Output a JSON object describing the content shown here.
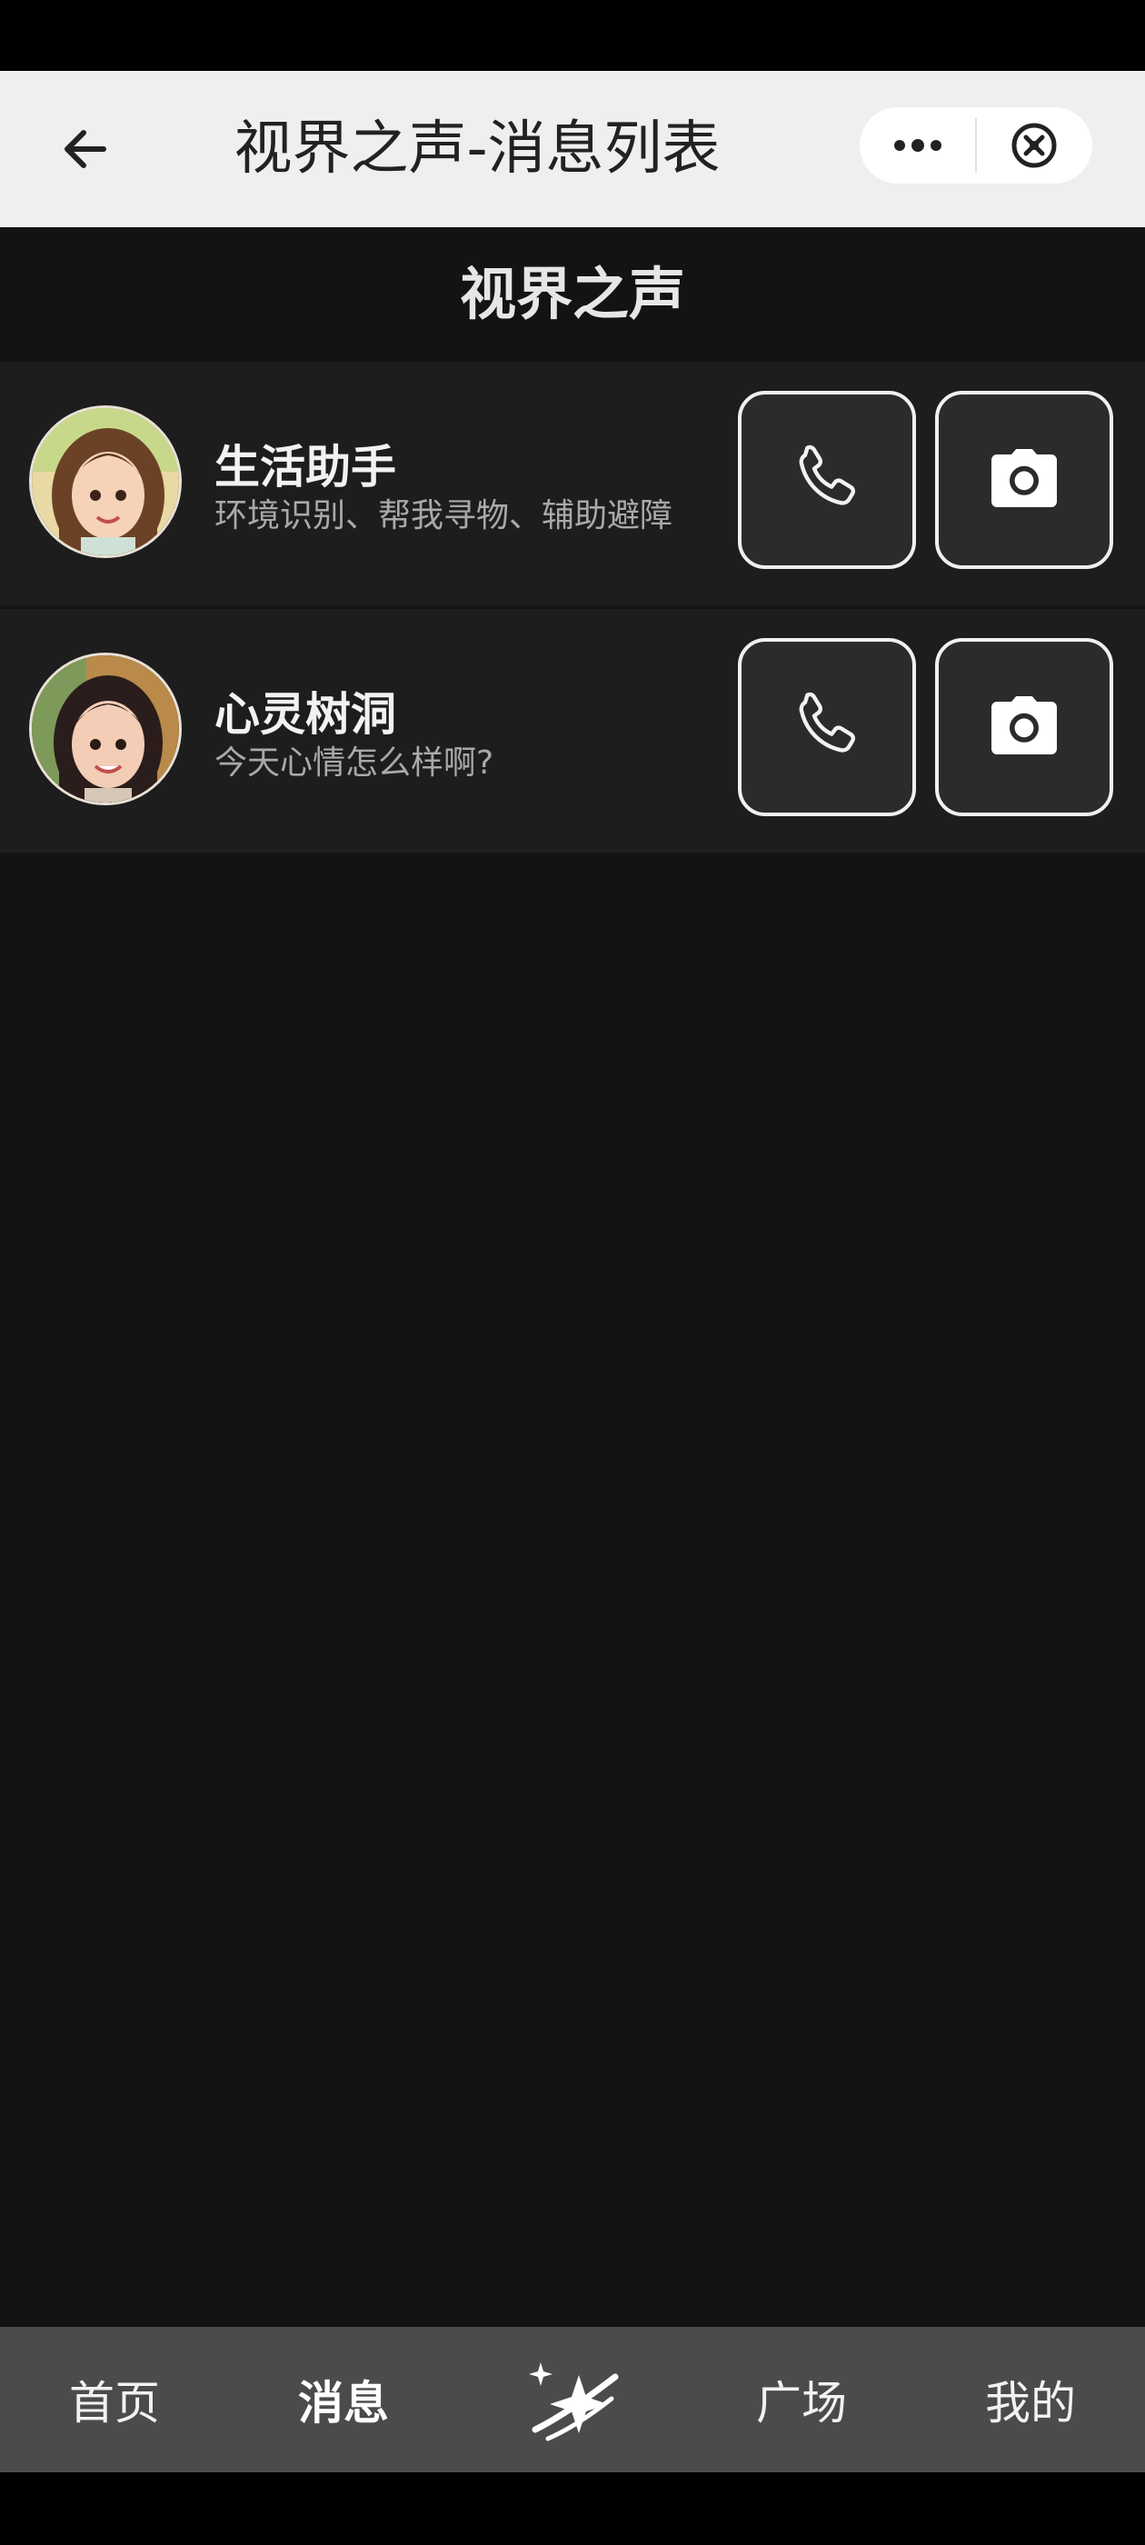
{
  "nav": {
    "title": "视界之声-消息列表",
    "back_icon": "arrow-left-icon",
    "more_icon": "more-dots-icon",
    "close_icon": "close-circle-icon"
  },
  "header": {
    "title": "视界之声"
  },
  "conversations": [
    {
      "name": "生活助手",
      "subtitle": "环境识别、帮我寻物、辅助避障",
      "avatar": "avatar-woman-light-hair"
    },
    {
      "name": "心灵树洞",
      "subtitle": "今天心情怎么样啊?",
      "avatar": "avatar-woman-dark-hair"
    }
  ],
  "actions": {
    "call_icon": "phone-icon",
    "camera_icon": "camera-icon"
  },
  "tabs": [
    {
      "label": "首页"
    },
    {
      "label": "消息",
      "active": true
    },
    {
      "label": "",
      "icon": "sparkle-logo-icon"
    },
    {
      "label": "广场"
    },
    {
      "label": "我的"
    }
  ],
  "colors": {
    "background": "#131313",
    "nav_bg": "#efefef",
    "row_bg": "#1d1d1d",
    "tabbar_bg": "#4b4b4d"
  }
}
